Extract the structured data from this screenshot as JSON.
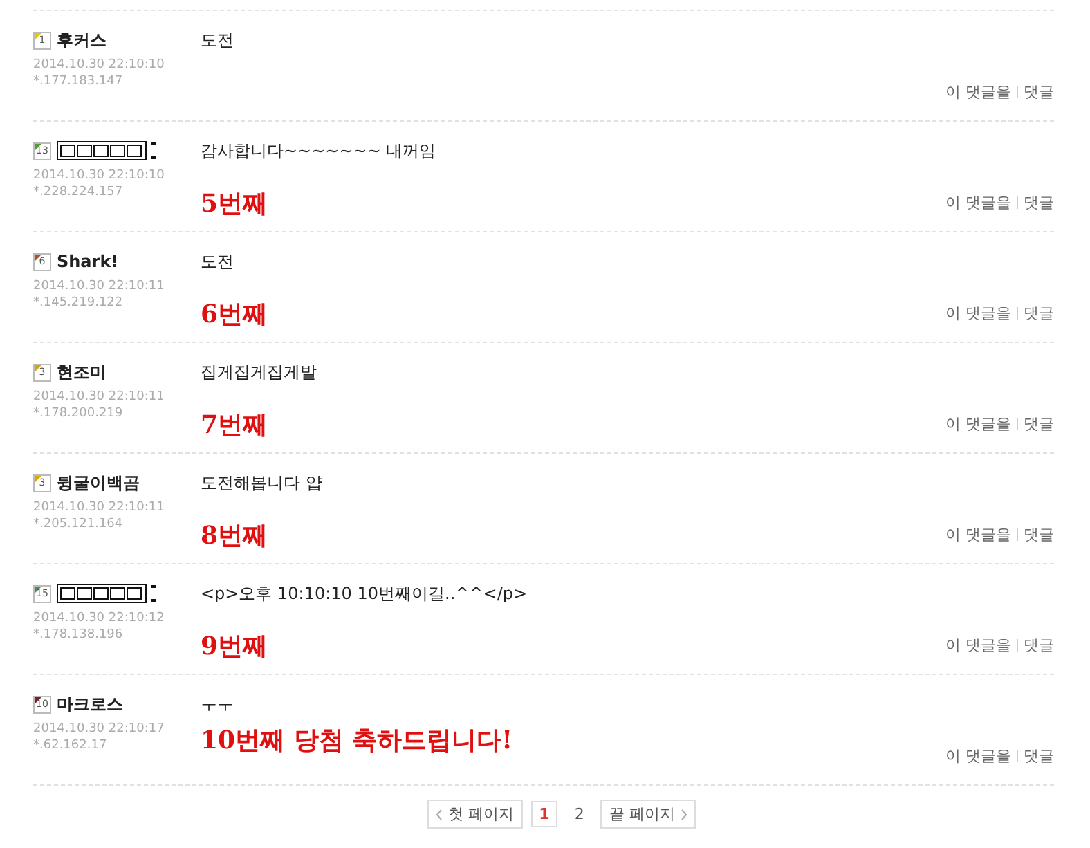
{
  "comments": [
    {
      "level": "1",
      "color": "#e8c800",
      "kind": "text",
      "nickname": "후커스",
      "date": "2014.10.30 22:10:10",
      "ip": "*.177.183.147",
      "content": "도전",
      "actions": [
        "이 댓글을",
        "댓글"
      ]
    },
    {
      "level": "13",
      "color": "#5a9a3a",
      "kind": "image",
      "date": "2014.10.30 22:10:10",
      "ip": "*.228.224.157",
      "content": "감사합니다~~~~~~~ 내꺼임",
      "annotation": "5번째",
      "actions": [
        "이 댓글을",
        "댓글"
      ]
    },
    {
      "level": "6",
      "color": "#b0502a",
      "kind": "text",
      "nickname": "Shark!",
      "date": "2014.10.30 22:10:11",
      "ip": "*.145.219.122",
      "content": "도전",
      "annotation": "6번째",
      "actions": [
        "이 댓글을",
        "댓글"
      ]
    },
    {
      "level": "3",
      "color": "#d8a800",
      "kind": "text",
      "nickname": "현조미",
      "date": "2014.10.30 22:10:11",
      "ip": "*.178.200.219",
      "content": "집게집게집게발",
      "annotation": "7번째",
      "actions": [
        "이 댓글을",
        "댓글"
      ]
    },
    {
      "level": "3",
      "color": "#d8a800",
      "kind": "text",
      "nickname": "뒹굴이백곰",
      "date": "2014.10.30 22:10:11",
      "ip": "*.205.121.164",
      "content": "도전해봅니다 얍",
      "annotation": "8번째",
      "actions": [
        "이 댓글을",
        "댓글"
      ]
    },
    {
      "level": "15",
      "color": "#4a8a5a",
      "kind": "image",
      "date": "2014.10.30 22:10:12",
      "ip": "*.178.138.196",
      "content": "<p>오후 10:10:10 10번째이길..^^</p>",
      "annotation": "9번째",
      "actions": [
        "이 댓글을",
        "댓글"
      ]
    },
    {
      "level": "10",
      "color": "#8a1a2a",
      "kind": "text",
      "nickname": "마크로스",
      "date": "2014.10.30 22:10:17",
      "ip": "*.62.162.17",
      "content": "ㅜㅜ",
      "annotation": "10번째 당첨 축하드립니다!",
      "actions": [
        "이 댓글을",
        "댓글"
      ]
    }
  ],
  "pagination": {
    "first": "첫 페이지",
    "pages": [
      {
        "label": "1",
        "selected": true
      },
      {
        "label": "2",
        "selected": false
      }
    ],
    "last": "끝 페이지"
  }
}
